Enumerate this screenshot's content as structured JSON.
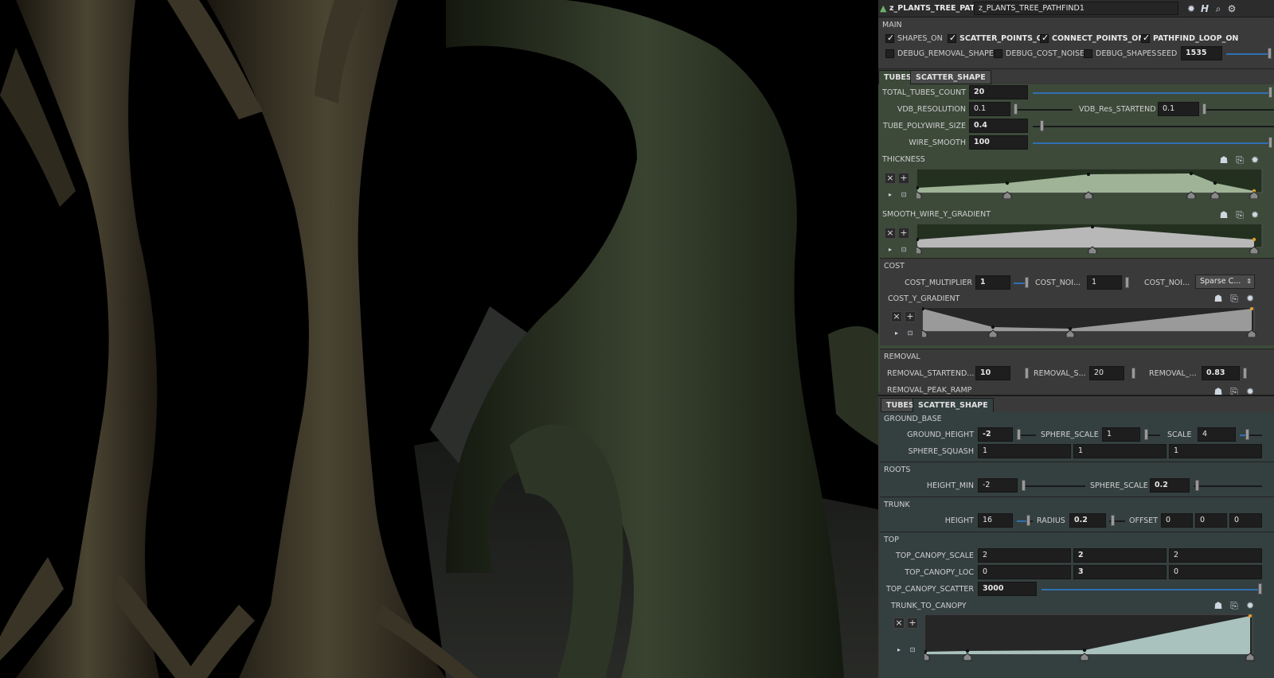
{
  "header": {
    "node_type": "z_PLANTS_TREE_PATHFIND",
    "node_name": "z_PLANTS_TREE_PATHFIND1"
  },
  "main": {
    "title": "MAIN",
    "toggles": [
      {
        "label": "SHAPES_ON",
        "checked": true
      },
      {
        "label": "SCATTER_POINTS_ON",
        "checked": true
      },
      {
        "label": "CONNECT_POINTS_ON",
        "checked": true
      },
      {
        "label": "PATHFIND_LOOP_ON",
        "checked": true
      }
    ],
    "debug_toggles": [
      {
        "label": "DEBUG_REMOVAL_SHAPES",
        "checked": false
      },
      {
        "label": "DEBUG_COST_NOISE",
        "checked": false
      },
      {
        "label": "DEBUG_SHAPES",
        "checked": false
      }
    ],
    "seed_label": "SEED",
    "seed_value": "1535"
  },
  "tubes_panel": {
    "tabs": [
      "TUBES",
      "SCATTER_SHAPE"
    ],
    "active_tab": "TUBES",
    "total_tubes_label": "TOTAL_TUBES_COUNT",
    "total_tubes_value": "20",
    "vdb_res_label": "VDB_RESOLUTION",
    "vdb_res_value": "0.1",
    "vdb_res_startend_label": "VDB_Res_STARTEND",
    "vdb_res_startend_value": "0.1",
    "polywire_label": "TUBE_POLYWIRE_SIZE",
    "polywire_value": "0.4",
    "wire_smooth_label": "WIRE_SMOOTH",
    "wire_smooth_value": "100",
    "thickness_label": "THICKNESS",
    "smooth_gradient_label": "SMOOTH_WIRE_Y_GRADIENT",
    "cost_label": "COST",
    "cost_multiplier_label": "COST_MULTIPLIER",
    "cost_multiplier_value": "1",
    "cost_noise_label_1": "COST_NOI...",
    "cost_noise_value_1": "1",
    "cost_noise_label_2": "COST_NOI...",
    "cost_noise_select": "Sparse C...",
    "cost_y_gradient_label": "COST_Y_GRADIENT",
    "removal_label": "REMOVAL",
    "removal_startend_label": "REMOVAL_STARTEND...",
    "removal_startend_value": "10",
    "removal_s_label": "REMOVAL_S...",
    "removal_s_value": "20",
    "removal_x_label": "REMOVAL_...",
    "removal_x_value": "0.83",
    "removal_peak_label": "REMOVAL_PEAK_RAMP"
  },
  "scatter_panel": {
    "tabs": [
      "TUBES",
      "SCATTER_SHAPE"
    ],
    "active_tab": "SCATTER_SHAPE",
    "ground_base_label": "GROUND_BASE",
    "ground_height_label": "GROUND_HEIGHT",
    "ground_height_value": "-2",
    "sphere_scale_label": "SPHERE_SCALE",
    "sphere_scale_value": "1",
    "scale_label": "SCALE",
    "scale_value": "4",
    "sphere_squash_label": "SPHERE_SQUASH",
    "sphere_squash_values": [
      "1",
      "1",
      "1"
    ],
    "roots_label": "ROOTS",
    "height_min_label": "HEIGHT_MIN",
    "height_min_value": "-2",
    "roots_sphere_scale_label": "SPHERE_SCALE",
    "roots_sphere_scale_value": "0.2",
    "trunk_label": "TRUNK",
    "height_label": "HEIGHT",
    "height_value": "16",
    "radius_label": "RADIUS",
    "radius_value": "0.2",
    "offset_label": "OFFSET",
    "offset_values": [
      "0",
      "0",
      "0"
    ],
    "top_label": "TOP",
    "top_canopy_scale_label": "TOP_CANOPY_SCALE",
    "top_canopy_scale_values": [
      "2",
      "2",
      "2"
    ],
    "top_canopy_loc_label": "TOP_CANOPY_LOC",
    "top_canopy_loc_values": [
      "0",
      "3",
      "0"
    ],
    "top_canopy_scatter_label": "TOP_CANOPY_SCATTER",
    "top_canopy_scatter_value": "3000",
    "trunk_to_canopy_label": "TRUNK_TO_CANOPY"
  },
  "colors": {
    "panel_bg": "#3a3a3a",
    "tubes_tab_bg": "#3d4a3a",
    "scatter_tab_bg": "#34403f",
    "slider_blue": "#2f6fb2"
  }
}
